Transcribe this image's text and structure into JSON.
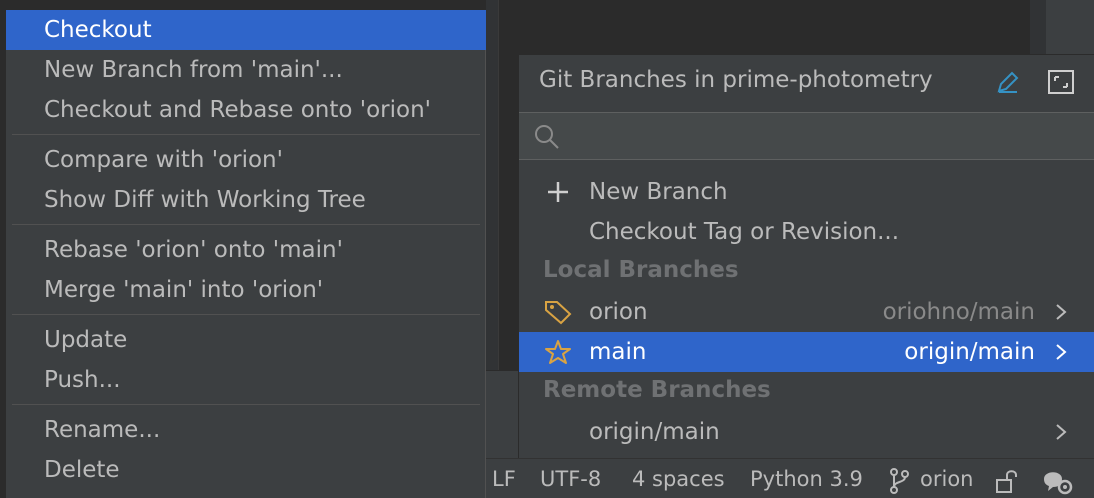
{
  "context_menu": {
    "items": [
      {
        "label": "Checkout",
        "selected": true
      },
      {
        "label": "New Branch from 'main'..."
      },
      {
        "label": "Checkout and Rebase onto 'orion'"
      },
      {
        "label": "Compare with 'orion'"
      },
      {
        "label": "Show Diff with Working Tree"
      },
      {
        "label": "Rebase 'orion' onto 'main'"
      },
      {
        "label": "Merge 'main' into 'orion'"
      },
      {
        "label": "Update"
      },
      {
        "label": "Push..."
      },
      {
        "label": "Rename..."
      },
      {
        "label": "Delete"
      }
    ]
  },
  "branches_popup": {
    "title": "Git Branches in prime-photometry",
    "search_value": "",
    "actions": {
      "new_branch": "New Branch",
      "checkout_tag": "Checkout Tag or Revision..."
    },
    "local_header": "Local Branches",
    "local": [
      {
        "name": "orion",
        "tracking": "oriohno/main",
        "icon": "tag-icon"
      },
      {
        "name": "main",
        "tracking": "origin/main",
        "icon": "star-icon",
        "selected": true
      }
    ],
    "remote_header": "Remote Branches",
    "remote": [
      {
        "name": "origin/main"
      }
    ]
  },
  "status_bar": {
    "line_separator": "LF",
    "encoding": "UTF-8",
    "indent": "4 spaces",
    "interpreter": "Python 3.9",
    "branch": "orion"
  },
  "colors": {
    "selection": "#2f65ca",
    "popup_bg": "#3c3f41",
    "accent_icon": "#d9a343",
    "edit_icon": "#3592c4"
  }
}
